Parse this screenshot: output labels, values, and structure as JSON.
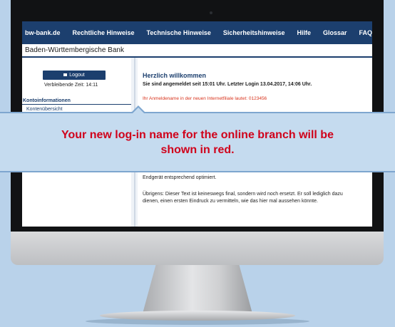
{
  "nav": {
    "items": [
      "bw-bank.de",
      "Rechtliche Hinweise",
      "Technische Hinweise",
      "Sicherheitshinweise",
      "Hilfe",
      "Glossar",
      "FAQ"
    ]
  },
  "brand": {
    "name": "Baden-Württembergische Bank"
  },
  "sidebar": {
    "logout_label": "Logout",
    "session_time": "Verbleibende Zeit: 14:11",
    "menu_title": "Kontoinformationen",
    "menu_item": "Kontenübersicht"
  },
  "main": {
    "welcome_title": "Herzlich willkommen",
    "login_info": "Sie sind angemeldet seit 15:01 Uhr. Letzter Login 13.04.2017, 14:06 Uhr.",
    "username_line": "Ihr Anmeldename in der neuen Internetfiliale lautet: 0123456",
    "device_line": "Endgerät entsprechend optimiert.",
    "disclaimer": "Übrigens: Dieser Text ist keineswegs final, sondern wird noch ersetzt. Er soll lediglich dazu dienen, einen ersten Eindruck zu vermitteln, wie das hier mal aussehen könnte."
  },
  "callout": {
    "text": "Your new log-in name for the online branch will be shown in red."
  },
  "colors": {
    "brand_navy": "#1c3f6e",
    "highlight_red": "#d0021b",
    "callout_background": "#c5dbef"
  }
}
